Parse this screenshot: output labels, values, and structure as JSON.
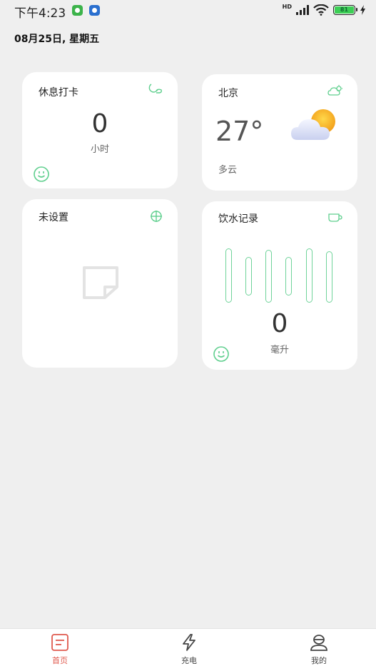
{
  "status_bar": {
    "time": "下午4:23",
    "network": "HD",
    "battery": "81",
    "icons": [
      "wechat-icon",
      "app-store-icon",
      "signal-icon",
      "wifi-icon",
      "battery-icon",
      "charging-icon"
    ]
  },
  "date_line": "08月25日, 星期五",
  "rest_card": {
    "title": "休息打卡",
    "value": "0",
    "unit": "小时",
    "icons": [
      "moon-icon",
      "smile-icon"
    ]
  },
  "weather_card": {
    "city": "北京",
    "temperature": "27°",
    "condition": "多云",
    "icons": [
      "cloud-sun-icon",
      "weather-illustration"
    ]
  },
  "unset_card": {
    "title": "未设置",
    "icons": [
      "crosshair-icon",
      "note-placeholder-icon"
    ]
  },
  "water_card": {
    "title": "饮水记录",
    "value": "0",
    "unit": "毫升",
    "icons": [
      "cup-icon",
      "smile-icon"
    ]
  },
  "bottom_nav": {
    "items": [
      {
        "label": "首页",
        "icon": "home-doc-icon",
        "active": true
      },
      {
        "label": "充电",
        "icon": "lightning-icon",
        "active": false
      },
      {
        "label": "我的",
        "icon": "profile-icon",
        "active": false
      }
    ]
  },
  "colors": {
    "accent_green": "#5fcf8e",
    "accent_red": "#e05a4e",
    "background": "#efefef"
  }
}
